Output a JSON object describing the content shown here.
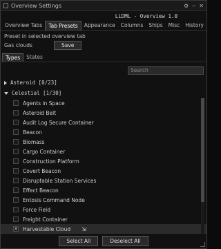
{
  "window": {
    "title": "Overview Settings",
    "controls": [
      "⚙",
      "‒",
      "✕"
    ],
    "profile_label": "LLDML - Overview 1.0"
  },
  "tabs": [
    {
      "label": "Overview Tabs",
      "active": false
    },
    {
      "label": "Tab Presets",
      "active": true
    },
    {
      "label": "Appearance",
      "active": false
    },
    {
      "label": "Columns",
      "active": false
    },
    {
      "label": "Ships",
      "active": false
    },
    {
      "label": "Misc",
      "active": false
    },
    {
      "label": "History",
      "active": false
    }
  ],
  "preset": {
    "hint": "Preset in selected overview tab",
    "name": "Gas clouds",
    "save_label": "Save"
  },
  "subtabs": [
    {
      "label": "Types",
      "active": true
    },
    {
      "label": "States",
      "active": false
    }
  ],
  "search": {
    "placeholder": "Search"
  },
  "groups": [
    {
      "label": "Asteroid [0/23]",
      "expanded": false
    },
    {
      "label": "Celestial [1/30]",
      "expanded": true
    }
  ],
  "items": [
    {
      "label": "Agents in Space",
      "checked": false
    },
    {
      "label": "Asteroid Belt",
      "checked": false
    },
    {
      "label": "Audit Log Secure Container",
      "checked": false
    },
    {
      "label": "Beacon",
      "checked": false
    },
    {
      "label": "Biomass",
      "checked": false
    },
    {
      "label": "Cargo Container",
      "checked": false
    },
    {
      "label": "Construction Platform",
      "checked": false
    },
    {
      "label": "Covert Beacon",
      "checked": false
    },
    {
      "label": "Disruptable Station Services",
      "checked": false
    },
    {
      "label": "Effect Beacon",
      "checked": false
    },
    {
      "label": "Entosis Command Node",
      "checked": false
    },
    {
      "label": "Force Field",
      "checked": false
    },
    {
      "label": "Freight Container",
      "checked": false
    },
    {
      "label": "Harvestable Cloud",
      "checked": true
    }
  ],
  "footer": {
    "select_all": "Select All",
    "deselect_all": "Deselect All"
  }
}
